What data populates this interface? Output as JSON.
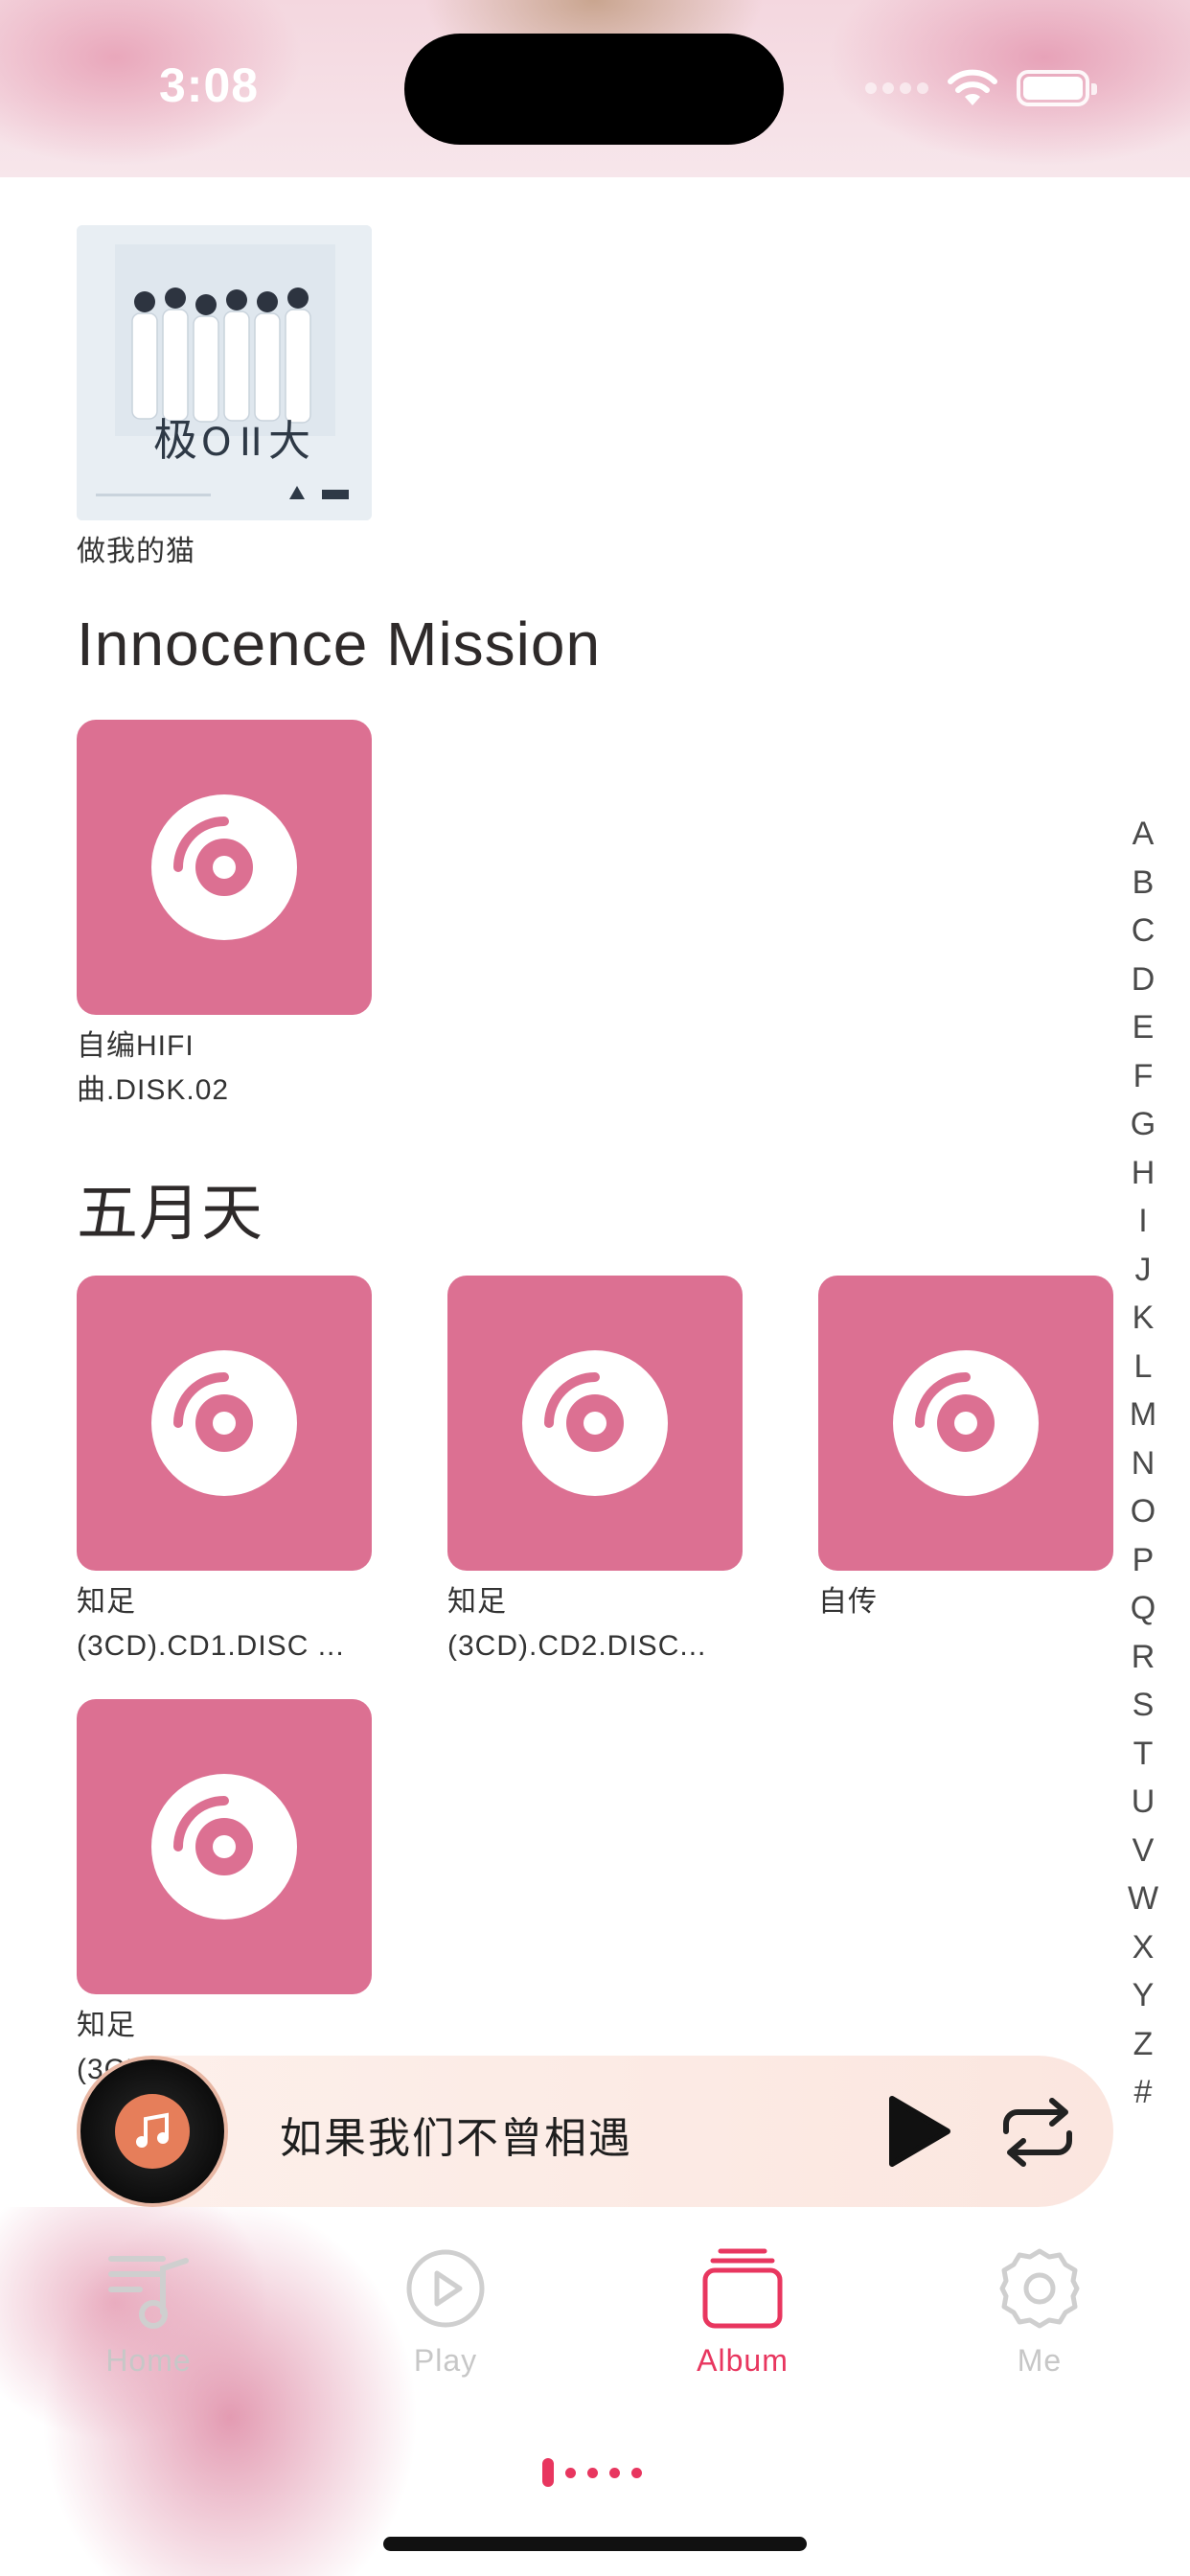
{
  "status_bar": {
    "time": "3:08"
  },
  "albums": {
    "top_album": {
      "title": "做我的猫"
    },
    "sections": [
      {
        "artist": "Innocence Mission",
        "albums": [
          {
            "title_line1": "自编HIFI",
            "title_line2": "曲.DISK.02"
          }
        ]
      },
      {
        "artist": "五月天",
        "albums": [
          {
            "title_line1": "知足",
            "title_line2": "(3CD).CD1.DISC ..."
          },
          {
            "title_line1": "知足",
            "title_line2": "(3CD).CD2.DISC..."
          },
          {
            "title_line1": "自传",
            "title_line2": ""
          },
          {
            "title_line1": "知足",
            "title_line2": "(3CD).CD3.DISC..."
          }
        ]
      }
    ]
  },
  "alphabet_index": [
    "A",
    "B",
    "C",
    "D",
    "E",
    "F",
    "G",
    "H",
    "I",
    "J",
    "K",
    "L",
    "M",
    "N",
    "O",
    "P",
    "Q",
    "R",
    "S",
    "T",
    "U",
    "V",
    "W",
    "X",
    "Y",
    "Z",
    "#"
  ],
  "mini_player": {
    "song_title": "如果我们不曾相遇",
    "icons": [
      "vinyl-disc-icon",
      "music-note-icon",
      "play-icon",
      "repeat-icon"
    ]
  },
  "tab_bar": {
    "tabs": [
      {
        "label": "Home",
        "icon": "playlist-icon"
      },
      {
        "label": "Play",
        "icon": "play-circle-icon"
      },
      {
        "label": "Album",
        "icon": "album-stack-icon"
      },
      {
        "label": "Me",
        "icon": "gear-icon"
      }
    ],
    "active_tab": "Album"
  },
  "colors": {
    "accent": "#e8365f",
    "album_cover": "#dc7092",
    "mini_player_bg": "#fbe6df",
    "inactive_tab": "#c7c7c7"
  }
}
